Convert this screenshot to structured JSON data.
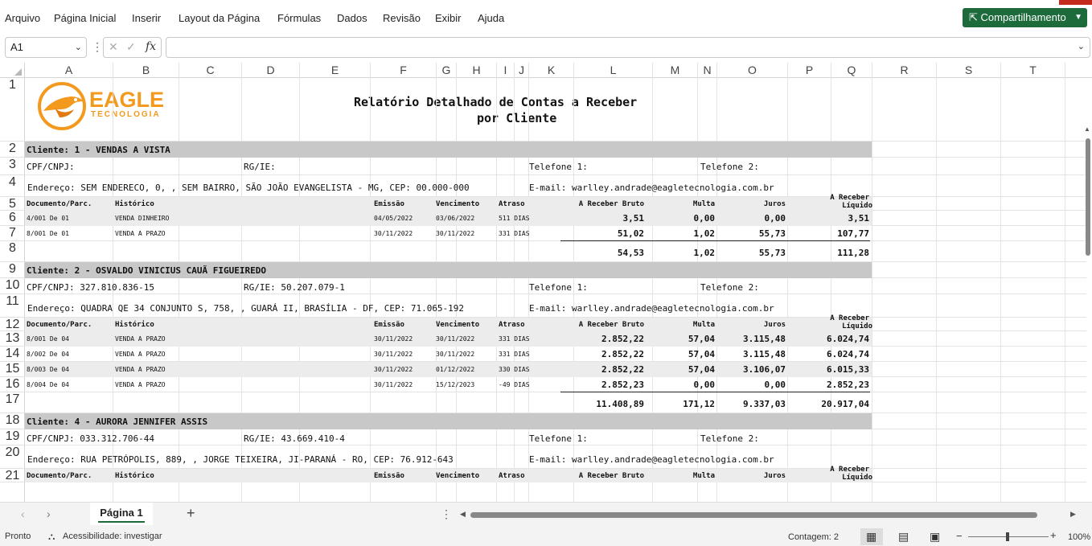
{
  "menu": [
    "Arquivo",
    "Página Inicial",
    "Inserir",
    "Layout da Página",
    "Fórmulas",
    "Dados",
    "Revisão",
    "Exibir",
    "Ajuda"
  ],
  "share_label": "Compartilhamento",
  "namebox": "A1",
  "fx": "fx",
  "columns": [
    "A",
    "B",
    "C",
    "D",
    "E",
    "F",
    "G",
    "H",
    "I",
    "J",
    "K",
    "L",
    "M",
    "N",
    "O",
    "P",
    "Q",
    "R",
    "S",
    "T"
  ],
  "rows": [
    "1",
    "2",
    "3",
    "4",
    "5",
    "6",
    "7",
    "8",
    "9",
    "10",
    "11",
    "12",
    "13",
    "14",
    "15",
    "16",
    "17",
    "18",
    "19",
    "20",
    "21"
  ],
  "logo": {
    "name": "EAGLE",
    "sub": "TECNOLOGIA"
  },
  "report_title": [
    "Relatório Detalhado de Contas a Receber",
    "por Cliente"
  ],
  "labels": {
    "cpf": "CPF/CNPJ:",
    "rg": "RG/IE:",
    "tel1": "Telefone 1:",
    "tel2": "Telefone 2:",
    "email": "E-mail: warlley.andrade@eagletecnologia.com.br"
  },
  "table_headers": [
    "Documento/Parc.",
    "Histórico",
    "Emissão",
    "Vencimento",
    "Atraso",
    "A Receber Bruto",
    "Multa",
    "Juros",
    "A Receber",
    "Líquido"
  ],
  "clients": [
    {
      "title": "Cliente: 1 - VENDAS A VISTA",
      "cpf": "CPF/CNPJ:",
      "rg": "RG/IE:",
      "address": "Endereço: SEM ENDERECO, 0, , SEM BAIRRO, SÃO JOÃO EVANGELISTA - MG, CEP: 00.000-000",
      "rows": [
        [
          "4/001 De 01",
          "VENDA DINHEIRO",
          "04/05/2022",
          "03/06/2022",
          "511 DIAS",
          "3,51",
          "0,00",
          "0,00",
          "3,51"
        ],
        [
          "8/001 De 01",
          "VENDA A PRAZO",
          "30/11/2022",
          "30/11/2022",
          "331 DIAS",
          "51,02",
          "1,02",
          "55,73",
          "107,77"
        ]
      ],
      "totals": [
        "54,53",
        "1,02",
        "55,73",
        "111,28"
      ]
    },
    {
      "title": "Cliente: 2 - OSVALDO VINICIUS CAUÃ FIGUEIREDO",
      "cpf": "CPF/CNPJ: 327.810.836-15",
      "rg": "RG/IE: 50.207.079-1",
      "address": "Endereço: QUADRA QE 34 CONJUNTO S, 758, , GUARÁ II, BRASÍLIA - DF, CEP: 71.065-192",
      "rows": [
        [
          "8/001 De 04",
          "VENDA A PRAZO",
          "30/11/2022",
          "30/11/2022",
          "331 DIAS",
          "2.852,22",
          "57,04",
          "3.115,48",
          "6.024,74"
        ],
        [
          "8/002 De 04",
          "VENDA A PRAZO",
          "30/11/2022",
          "30/11/2022",
          "331 DIAS",
          "2.852,22",
          "57,04",
          "3.115,48",
          "6.024,74"
        ],
        [
          "8/003 De 04",
          "VENDA A PRAZO",
          "30/11/2022",
          "01/12/2022",
          "330 DIAS",
          "2.852,22",
          "57,04",
          "3.106,07",
          "6.015,33"
        ],
        [
          "8/004 De 04",
          "VENDA A PRAZO",
          "30/11/2022",
          "15/12/2023",
          "-49 DIAS",
          "2.852,23",
          "0,00",
          "0,00",
          "2.852,23"
        ]
      ],
      "totals": [
        "11.408,89",
        "171,12",
        "9.337,03",
        "20.917,04"
      ]
    },
    {
      "title": "Cliente: 4 - AURORA JENNIFER ASSIS",
      "cpf": "CPF/CNPJ: 033.312.706-44",
      "rg": "RG/IE: 43.669.410-4",
      "address": "Endereço: RUA PETRÓPOLIS, 889, , JORGE TEIXEIRA, JI-PARANÁ - RO, CEP: 76.912-643"
    }
  ],
  "sheet_tab": "Página 1",
  "status": {
    "ready": "Pronto",
    "accessibility": "Acessibilidade: investigar",
    "count": "Contagem: 2",
    "zoom": "100%"
  },
  "colors": {
    "accent": "#1d6b3b",
    "band": "#c8c8c8",
    "logo": "#f39a1e"
  }
}
